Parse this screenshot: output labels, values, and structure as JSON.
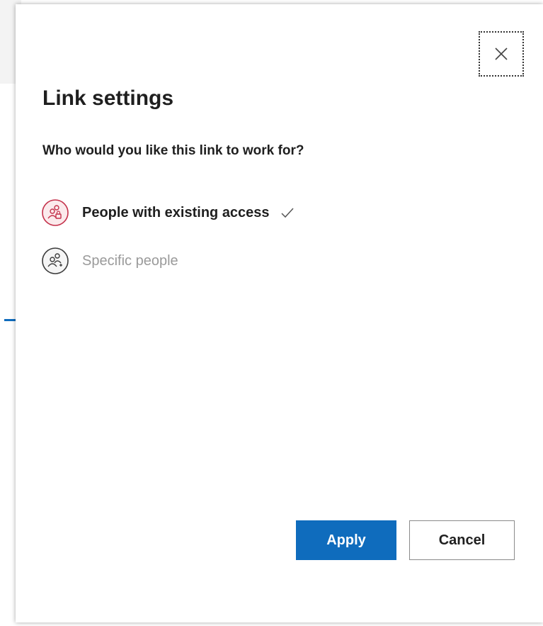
{
  "dialog": {
    "title": "Link settings",
    "question": "Who would you like this link to work for?",
    "close_icon": "close-icon",
    "options": [
      {
        "label": "People with existing access",
        "icon": "people-lock-icon",
        "selected": true,
        "icon_color": "#c4314b"
      },
      {
        "label": "Specific people",
        "icon": "people-add-icon",
        "selected": false,
        "icon_color": "#3b3b3b"
      }
    ],
    "apply_label": "Apply",
    "cancel_label": "Cancel"
  },
  "colors": {
    "accent": "#0f6cbd",
    "selected_icon": "#c4314b",
    "disabled_text": "#9a9a9a"
  }
}
